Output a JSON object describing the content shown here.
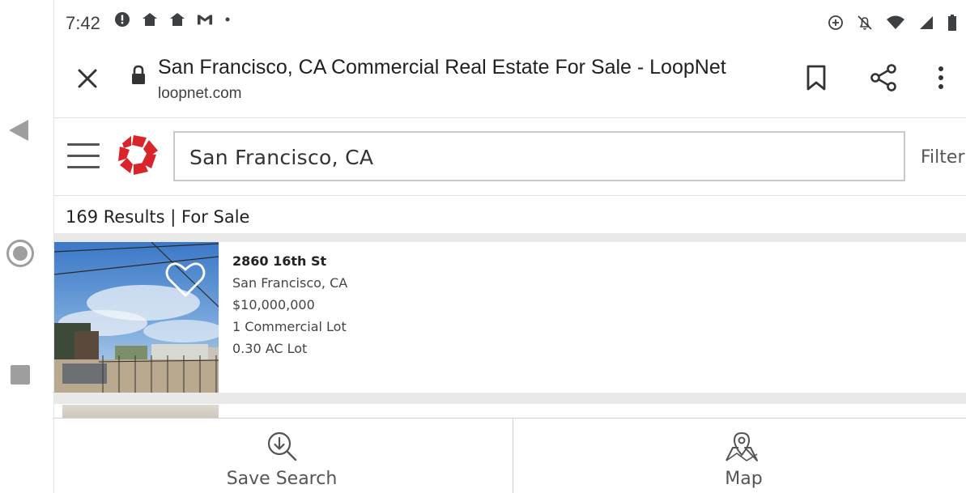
{
  "status_bar": {
    "time": "7:42",
    "left_icons": [
      "alert-icon",
      "home-icon",
      "home-icon",
      "gmail-icon",
      "dot-icon"
    ],
    "right_icons": [
      "data-saver-icon",
      "notifications-off-icon",
      "wifi-icon",
      "signal-icon",
      "battery-icon"
    ]
  },
  "browser": {
    "page_title": "San Francisco, CA Commercial Real Estate For Sale - LoopNet",
    "url": "loopnet.com"
  },
  "site_header": {
    "search_value": "San Francisco, CA",
    "filter_label": "Filter"
  },
  "results": {
    "summary": "169 Results | For Sale"
  },
  "listings": [
    {
      "address": "2860 16th St",
      "city": "San Francisco, CA",
      "price": "$10,000,000",
      "type": "1 Commercial Lot",
      "lot_size": "0.30 AC Lot"
    }
  ],
  "bottom_bar": {
    "save_search_label": "Save Search",
    "map_label": "Map"
  },
  "colors": {
    "brand_red": "#d9252a",
    "icon_gray": "#555555",
    "nav_gray": "#9e9e9e"
  }
}
